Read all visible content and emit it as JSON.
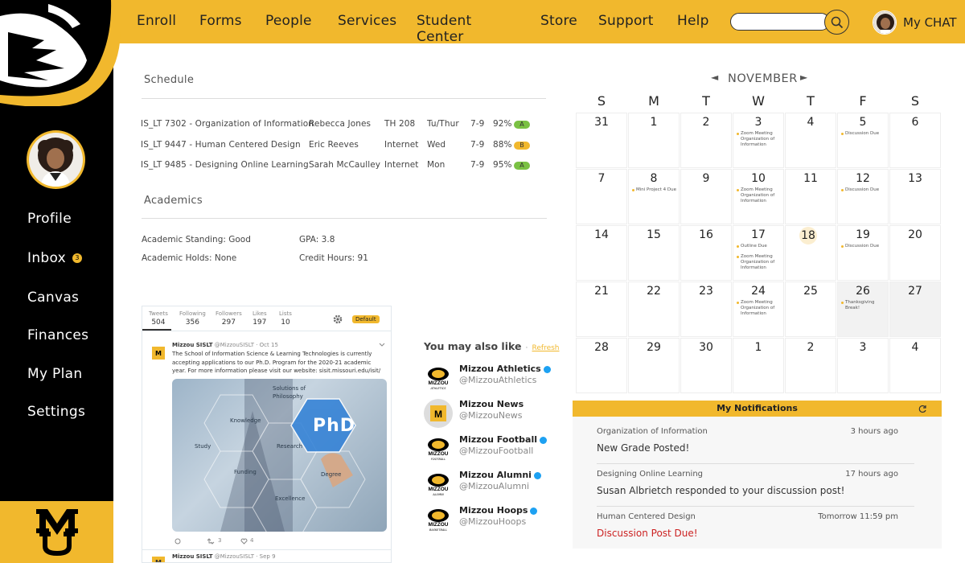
{
  "nav": {
    "items": [
      "Enroll",
      "Forms",
      "People",
      "Services",
      "Student Center",
      "Store",
      "Support",
      "Help"
    ],
    "search_placeholder": "",
    "chat_label": "My CHAT"
  },
  "sidebar": {
    "items": [
      {
        "label": "Profile"
      },
      {
        "label": "Inbox",
        "badge": "3"
      },
      {
        "label": "Canvas"
      },
      {
        "label": "Finances"
      },
      {
        "label": "My Plan"
      },
      {
        "label": "Settings"
      }
    ]
  },
  "schedule": {
    "title": "Schedule",
    "rows": [
      {
        "course": "IS_LT 7302 - Organization of Information",
        "instructor": "Rebecca Jones",
        "location": "TH 208",
        "days": "Tu/Thur",
        "time": "7-9",
        "pct": "92%",
        "grade": "A",
        "grade_color": "#7ac143"
      },
      {
        "course": "IS_LT 9447 - Human Centered Design",
        "instructor": "Eric Reeves",
        "location": "Internet",
        "days": "Wed",
        "time": "7-9",
        "pct": "88%",
        "grade": "B",
        "grade_color": "#F1B82D"
      },
      {
        "course": "IS_LT 9485 - Designing Online Learning",
        "instructor": "Sarah McCaulley",
        "location": "Internet",
        "days": "Mon",
        "time": "7-9",
        "pct": "95%",
        "grade": "A",
        "grade_color": "#7ac143"
      }
    ]
  },
  "academics": {
    "title": "Academics",
    "standing": "Academic Standing: Good",
    "gpa": "GPA: 3.8",
    "holds": "Academic Holds: None",
    "credits": "Credit Hours: 91"
  },
  "twitter": {
    "stats": [
      {
        "label": "Tweets",
        "value": "504"
      },
      {
        "label": "Following",
        "value": "356"
      },
      {
        "label": "Followers",
        "value": "297"
      },
      {
        "label": "Likes",
        "value": "197"
      },
      {
        "label": "Lists",
        "value": "10"
      }
    ],
    "default_badge": "Default",
    "tweet1": {
      "author": "Mizzou SISLT",
      "handle": "@MizzouSISLT",
      "date": "Oct 15",
      "text": "The School of Information Science & Learning Technologies is currently accepting applications to our Ph.D. Program for the 2020-21 academic year. For more information please visit our website: sisit.missouri.edu/isit/",
      "img_label": "PhD",
      "img_words": [
        "Solutions of",
        "Philosophy",
        "Knowledge",
        "Study",
        "Research",
        "Funding",
        "Degree",
        "Excellence"
      ],
      "retweets": "3",
      "likes": "4"
    },
    "tweet2": {
      "author": "Mizzou SISLT",
      "handle": "@MizzouSISLT",
      "date": "Sep 9"
    }
  },
  "suggestions": {
    "title": "You may also like",
    "refresh": "Refresh",
    "items": [
      {
        "name": "Mizzou Athletics",
        "handle": "@MizzouAthletics",
        "logo_text": "ATHLETICS"
      },
      {
        "name": "Mizzou News",
        "handle": "@MizzouNews",
        "logo_text": ""
      },
      {
        "name": "Mizzou Football",
        "handle": "@MizzouFootball",
        "logo_text": "FOOTBALL"
      },
      {
        "name": "Mizzou Alumni",
        "handle": "@MizzouAlumni",
        "logo_text": "ALUMNI"
      },
      {
        "name": "Mizzou Hoops",
        "handle": "@MizzouHoops",
        "logo_text": "BASKETBALL"
      }
    ]
  },
  "calendar": {
    "month": "NOVEMBER",
    "dow": [
      "S",
      "M",
      "T",
      "W",
      "T",
      "F",
      "S"
    ],
    "days": [
      {
        "n": "31",
        "ev": []
      },
      {
        "n": "1",
        "ev": []
      },
      {
        "n": "2",
        "ev": []
      },
      {
        "n": "3",
        "ev": [
          "Zoom Meeting Organization of Information"
        ]
      },
      {
        "n": "4",
        "ev": []
      },
      {
        "n": "5",
        "ev": [
          "Discussion Due"
        ]
      },
      {
        "n": "6",
        "ev": []
      },
      {
        "n": "7",
        "ev": []
      },
      {
        "n": "8",
        "ev": [
          "Mini Project 4 Due"
        ]
      },
      {
        "n": "9",
        "ev": []
      },
      {
        "n": "10",
        "ev": [
          "Zoom Meeting Organization of Information"
        ]
      },
      {
        "n": "11",
        "ev": []
      },
      {
        "n": "12",
        "ev": [
          "Discussion Due"
        ]
      },
      {
        "n": "13",
        "ev": []
      },
      {
        "n": "14",
        "ev": []
      },
      {
        "n": "15",
        "ev": []
      },
      {
        "n": "16",
        "ev": []
      },
      {
        "n": "17",
        "ev": [
          "Outline Due",
          "Zoom Meeting Organization of Information"
        ]
      },
      {
        "n": "18",
        "ev": [],
        "today": true
      },
      {
        "n": "19",
        "ev": [
          "Discussion Due"
        ]
      },
      {
        "n": "20",
        "ev": []
      },
      {
        "n": "21",
        "ev": []
      },
      {
        "n": "22",
        "ev": []
      },
      {
        "n": "23",
        "ev": []
      },
      {
        "n": "24",
        "ev": [
          "Zoom Meeting Organization of Information"
        ]
      },
      {
        "n": "25",
        "ev": []
      },
      {
        "n": "26",
        "ev": [
          "Thanksgiving Break!"
        ],
        "shaded": true
      },
      {
        "n": "27",
        "ev": [],
        "shaded": true
      },
      {
        "n": "28",
        "ev": []
      },
      {
        "n": "29",
        "ev": []
      },
      {
        "n": "30",
        "ev": []
      },
      {
        "n": "1",
        "ev": []
      },
      {
        "n": "2",
        "ev": []
      },
      {
        "n": "3",
        "ev": []
      },
      {
        "n": "4",
        "ev": []
      }
    ]
  },
  "notifications": {
    "title": "My Notifications",
    "items": [
      {
        "course": "Organization of Information",
        "time": "3 hours ago",
        "msg": "New Grade Posted!",
        "alert": false
      },
      {
        "course": "Designing Online Learning",
        "time": "17 hours ago",
        "msg": "Susan Albrietch responded to your discussion post!",
        "alert": false
      },
      {
        "course": "Human Centered Design",
        "time": "Tomorrow 11:59 pm",
        "msg": "Discussion Post Due!",
        "alert": true
      }
    ]
  },
  "colors": {
    "gold": "#F1B82D",
    "black": "#000000",
    "alert_red": "#cc2222"
  }
}
